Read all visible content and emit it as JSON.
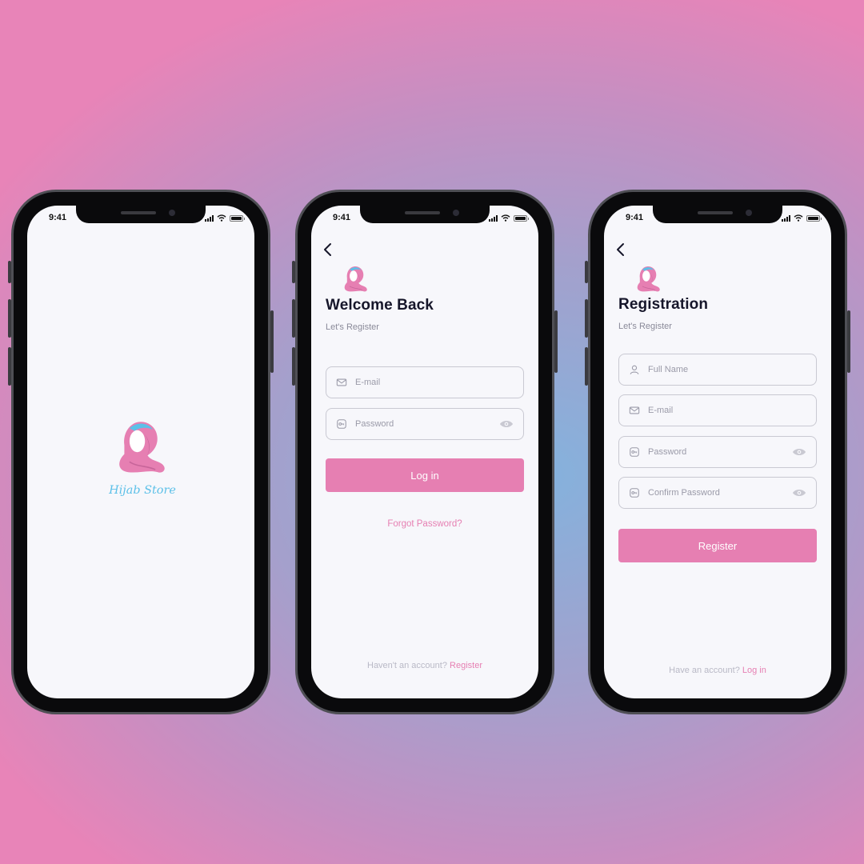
{
  "status_bar": {
    "time": "9:41"
  },
  "splash": {
    "brand_name": "Hijab Store"
  },
  "login": {
    "title": "Welcome Back",
    "subtitle": "Let's Register",
    "email_placeholder": "E-mail",
    "password_placeholder": "Password",
    "login_button": "Log in",
    "forgot_password": "Forgot Password?",
    "footer_prompt": "Haven't an account?",
    "footer_link": "Register"
  },
  "register": {
    "title": "Registration",
    "subtitle": "Let's Register",
    "fullname_placeholder": "Full Name",
    "email_placeholder": "E-mail",
    "password_placeholder": "Password",
    "confirm_password_placeholder": "Confirm Password",
    "register_button": "Register",
    "footer_prompt": "Have an account?",
    "footer_link": "Log in"
  },
  "colors": {
    "accent_pink": "#e67fb2",
    "logo_blue": "#5cc0e8",
    "screen_bg": "#f7f7fb"
  },
  "icons": [
    "back-arrow-icon",
    "mail-icon",
    "key-icon",
    "eye-icon",
    "user-icon",
    "signal-icon",
    "wifi-icon",
    "battery-icon"
  ]
}
